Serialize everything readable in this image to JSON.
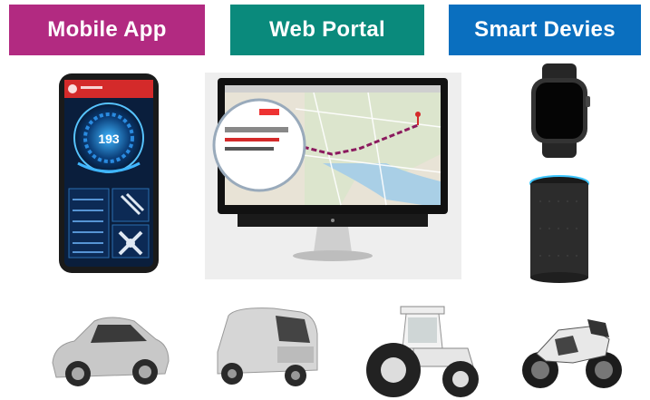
{
  "headers": {
    "mobile": "Mobile App",
    "web": "Web Portal",
    "smart": "Smart Devies"
  },
  "colors": {
    "mobile": "#b22a81",
    "web": "#0a8a7c",
    "smart": "#0a6fbf"
  },
  "phone": {
    "speed_readout": "193"
  },
  "icons": [
    "smartphone-dashboard",
    "desktop-monitor-map",
    "smartwatch",
    "smart-speaker",
    "car",
    "truck",
    "tractor",
    "motorcycle"
  ]
}
